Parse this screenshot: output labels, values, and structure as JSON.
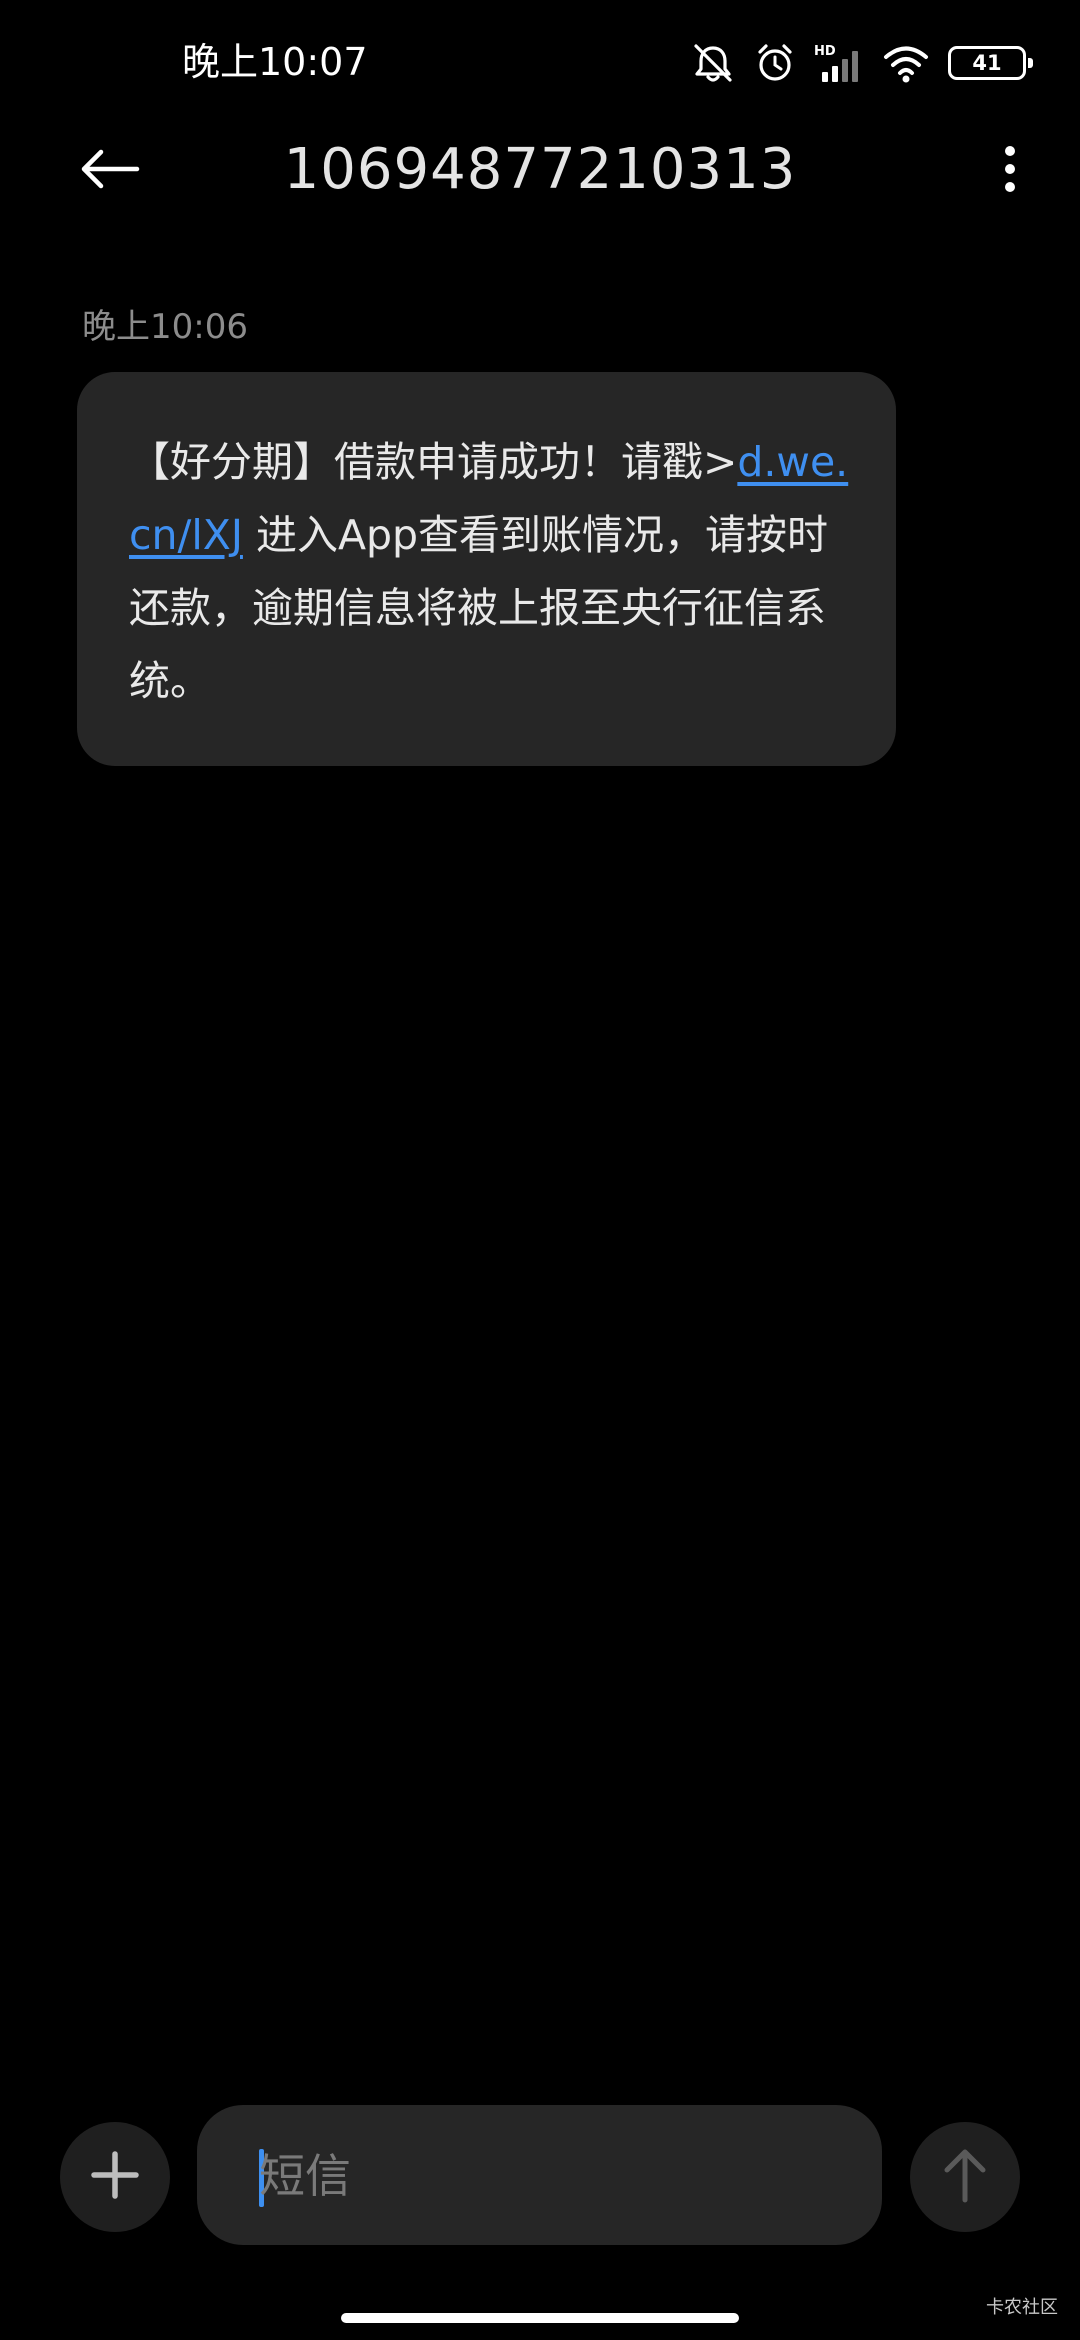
{
  "status_bar": {
    "time": "晚上10:07",
    "icons": [
      "bell-muted-icon",
      "alarm-icon",
      "hd-signal-icon",
      "wifi-icon",
      "battery-icon"
    ],
    "network_badge": "HD",
    "battery_level": "41"
  },
  "header": {
    "title": "10694877210313",
    "back_icon": "arrow-left-icon",
    "more_icon": "more-vertical-icon"
  },
  "conversation": {
    "messages": [
      {
        "time": "晚上10:06",
        "text_before_link": "【好分期】借款申请成功！请戳>",
        "link": "d.we.cn/lXJ",
        "text_after_link": " 进入App查看到账情况，请按时还款，逾期信息将被上报至央行征信系统。"
      }
    ]
  },
  "composer": {
    "placeholder": "短信",
    "attach_icon": "plus-icon",
    "send_icon": "arrow-up-icon"
  },
  "watermark": "卡农社区",
  "colors": {
    "background": "#000000",
    "bubble": "#262626",
    "link": "#3f8ff0",
    "cursor": "#3d8ff0",
    "muted_text": "#8c8c8c"
  }
}
